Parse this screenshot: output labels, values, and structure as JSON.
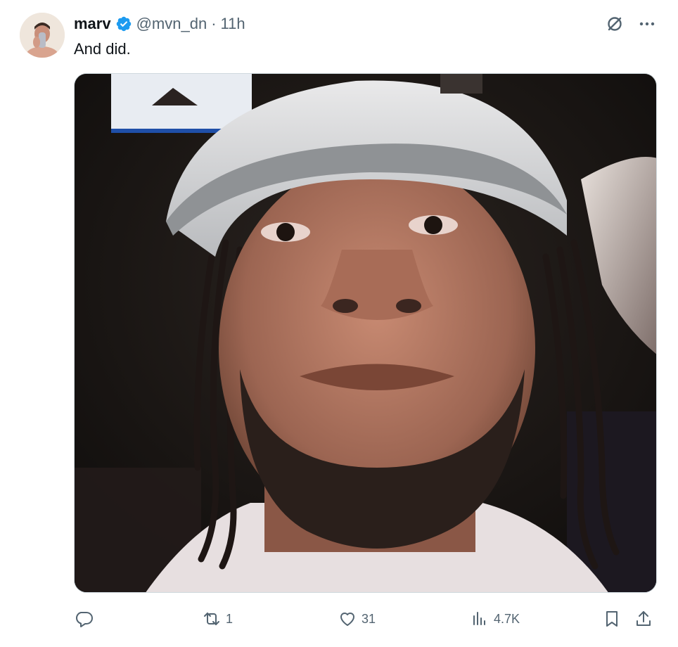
{
  "author": {
    "name": "marv",
    "handle": "@mvn_dn",
    "separator": "·",
    "time": "11h",
    "verified_color": "#1d9bf0"
  },
  "tweet": {
    "text": "And did."
  },
  "media": {
    "description_icon": "photo"
  },
  "actions": {
    "reply_icon": "reply-icon",
    "retweet_count": "1",
    "like_count": "31",
    "views_count": "4.7K",
    "bookmark_icon": "bookmark-icon",
    "share_icon": "share-icon"
  },
  "colors": {
    "text_primary": "#0f1419",
    "text_secondary": "#536471",
    "accent": "#1d9bf0"
  }
}
